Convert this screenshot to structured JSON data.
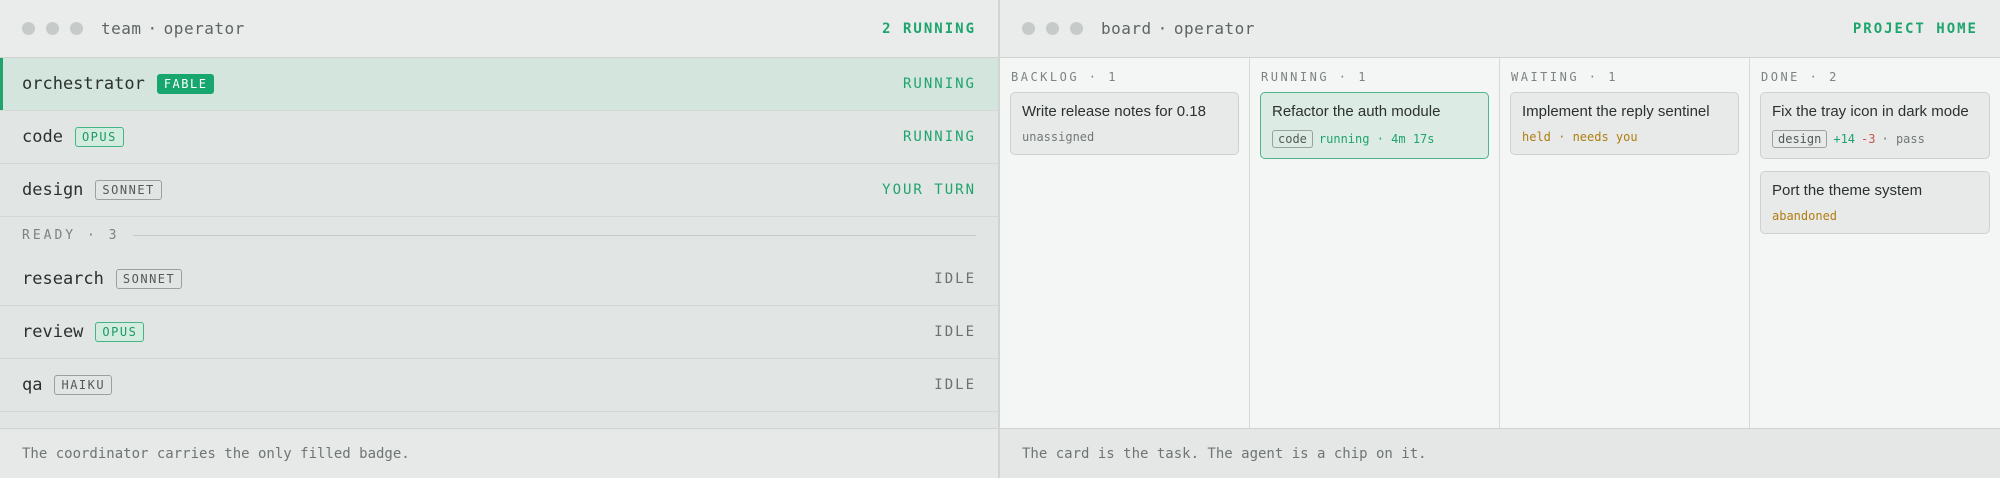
{
  "team": {
    "title_left": "team",
    "sep": "·",
    "title_right": "operator",
    "status": "2 RUNNING",
    "rows": [
      {
        "name": "orchestrator",
        "model": "FABLE",
        "status": "RUNNING"
      },
      {
        "name": "code",
        "model": "OPUS",
        "status": "RUNNING"
      },
      {
        "name": "design",
        "model": "SONNET",
        "status": "YOUR TURN"
      }
    ],
    "ready_label": "READY · 3",
    "ready_rows": [
      {
        "name": "research",
        "model": "SONNET",
        "status": "IDLE"
      },
      {
        "name": "review",
        "model": "OPUS",
        "status": "IDLE"
      },
      {
        "name": "qa",
        "model": "HAIKU",
        "status": "IDLE"
      }
    ],
    "footer": "The coordinator carries the only filled badge."
  },
  "board": {
    "title_left": "board",
    "sep": "·",
    "title_right": "operator",
    "project_home": "PROJECT HOME",
    "columns": [
      {
        "header": "BACKLOG · 1",
        "cards": [
          {
            "title": "Write release notes for 0.18",
            "meta": "unassigned"
          }
        ]
      },
      {
        "header": "RUNNING · 1",
        "cards": [
          {
            "title": "Refactor the auth module",
            "chip": "code",
            "meta": "running · 4m 17s"
          }
        ]
      },
      {
        "header": "WAITING · 1",
        "cards": [
          {
            "title": "Implement the reply sentinel",
            "meta": "held · needs you"
          }
        ]
      },
      {
        "header": "DONE · 2",
        "cards": [
          {
            "title": "Fix the tray icon in dark mode",
            "chip": "design",
            "plus": "+14",
            "minus": "-3",
            "result": "· pass"
          },
          {
            "title": "Port the theme system",
            "meta": "abandoned"
          }
        ]
      }
    ],
    "footer": "The card is the task. The agent is a chip on it."
  },
  "colors": {
    "accent": "#1fa46e",
    "waiting": "#b07d10",
    "removed": "#c9544c"
  }
}
